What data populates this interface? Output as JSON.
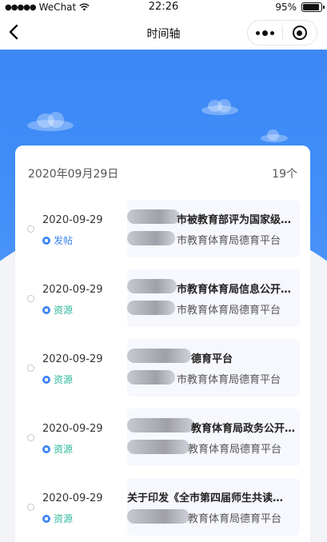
{
  "status_bar": {
    "carrier": "WeChat",
    "time": "22:26",
    "battery": "95%"
  },
  "nav": {
    "title": "时间轴"
  },
  "colors": {
    "accent": "#3d86f5",
    "post_tag": "#3d86f5",
    "resource_tag": "#2fb99e"
  },
  "summary": {
    "date": "2020年09月29日",
    "count": "19个"
  },
  "items": [
    {
      "date": "2020-09-29",
      "tag": "发帖",
      "tag_type": "post",
      "title": "市被教育部评为国家级…",
      "source": "市教育体育局德育平台"
    },
    {
      "date": "2020-09-29",
      "tag": "资源",
      "tag_type": "resource",
      "title": "市教育体育局信息公开…",
      "source": "市教育体育局德育平台"
    },
    {
      "date": "2020-09-29",
      "tag": "资源",
      "tag_type": "resource",
      "title": "德育平台",
      "source": "市教育体育局德育平台"
    },
    {
      "date": "2020-09-29",
      "tag": "资源",
      "tag_type": "resource",
      "title": "教育体育局政务公开…",
      "source": "教育体育局德育平台"
    },
    {
      "date": "2020-09-29",
      "tag": "资源",
      "tag_type": "resource",
      "title": "关于印发《全市第四届师生共读…",
      "source": "教育体育局德育平台"
    }
  ]
}
